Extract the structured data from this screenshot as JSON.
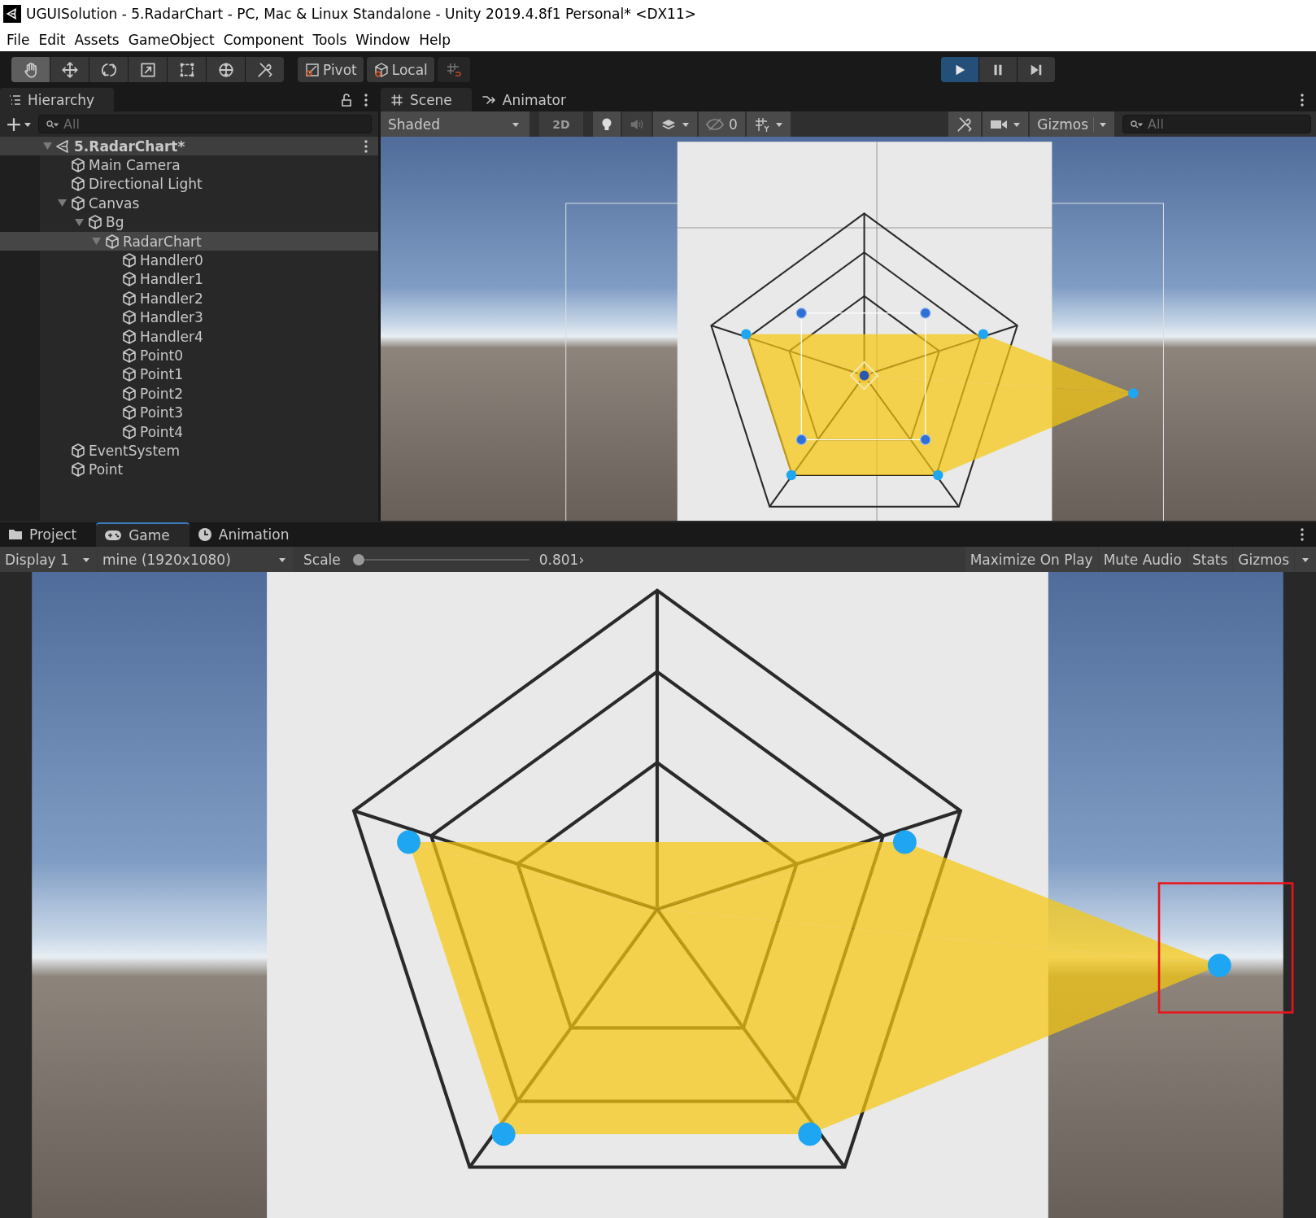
{
  "window": {
    "title": "UGUISolution - 5.RadarChart - PC, Mac & Linux Standalone - Unity 2019.4.8f1 Personal* <DX11>"
  },
  "menu_bar": [
    "File",
    "Edit",
    "Assets",
    "GameObject",
    "Component",
    "Tools",
    "Window",
    "Help"
  ],
  "toolbar": {
    "tools": [
      {
        "kind": "hand",
        "selected": true
      },
      {
        "kind": "move",
        "selected": false
      },
      {
        "kind": "rotate",
        "selected": false
      },
      {
        "kind": "scale",
        "selected": false
      },
      {
        "kind": "rect",
        "selected": false
      },
      {
        "kind": "transform",
        "selected": false
      },
      {
        "kind": "custom",
        "selected": false
      }
    ],
    "pivot": "Pivot",
    "space": "Local",
    "playback": [
      {
        "kind": "play",
        "selected": true
      },
      {
        "kind": "pause",
        "selected": false
      },
      {
        "kind": "step",
        "selected": false
      }
    ]
  },
  "hierarchy": {
    "tab": "Hierarchy",
    "search": {
      "placeholder": "All"
    },
    "tree": [
      {
        "label": "5.RadarChart*",
        "kind": "scene",
        "expanded": true,
        "children": [
          {
            "label": "Main Camera",
            "kind": "object",
            "selected": false
          },
          {
            "label": "Directional Light",
            "kind": "object",
            "selected": false
          },
          {
            "label": "Canvas",
            "kind": "object",
            "expanded": true,
            "selected": false,
            "children": [
              {
                "label": "Bg",
                "kind": "object",
                "expanded": true,
                "selected": false,
                "children": [
                  {
                    "label": "RadarChart",
                    "kind": "object",
                    "expanded": true,
                    "selected": true,
                    "children": [
                      {
                        "label": "Handler0",
                        "kind": "object",
                        "selected": false
                      },
                      {
                        "label": "Handler1",
                        "kind": "object",
                        "selected": false
                      },
                      {
                        "label": "Handler2",
                        "kind": "object",
                        "selected": false
                      },
                      {
                        "label": "Handler3",
                        "kind": "object",
                        "selected": false
                      },
                      {
                        "label": "Handler4",
                        "kind": "object",
                        "selected": false
                      },
                      {
                        "label": "Point0",
                        "kind": "object",
                        "selected": false
                      },
                      {
                        "label": "Point1",
                        "kind": "object",
                        "selected": false
                      },
                      {
                        "label": "Point2",
                        "kind": "object",
                        "selected": false
                      },
                      {
                        "label": "Point3",
                        "kind": "object",
                        "selected": false
                      },
                      {
                        "label": "Point4",
                        "kind": "object",
                        "selected": false
                      }
                    ]
                  }
                ]
              }
            ]
          },
          {
            "label": "EventSystem",
            "kind": "object",
            "selected": false
          },
          {
            "label": "Point",
            "kind": "object",
            "selected": false
          }
        ]
      }
    ]
  },
  "scene_view": {
    "tabs": [
      {
        "label": "Scene",
        "kind": "scene",
        "selected": true
      },
      {
        "label": "Animator",
        "kind": "animator",
        "selected": false
      }
    ],
    "shading": "Shaded",
    "toggles": [
      {
        "kind": "dimension",
        "label": "2D",
        "on": false
      },
      {
        "kind": "lighting",
        "on": true
      },
      {
        "kind": "audio",
        "on": false
      }
    ],
    "hidden_count": "0",
    "gizmos": "Gizmos",
    "search": {
      "placeholder": "All"
    }
  },
  "game_view": {
    "tabs": [
      {
        "label": "Project",
        "kind": "project",
        "selected": false
      },
      {
        "label": "Game",
        "kind": "game",
        "selected": true
      },
      {
        "label": "Animation",
        "kind": "animation",
        "selected": false
      }
    ],
    "display": "Display 1",
    "resolution": "mine (1920x1080)",
    "scale": {
      "label": "Scale",
      "level": 0,
      "reading": "0.801›"
    },
    "buttons": [
      "Maximize On Play",
      "Mute Audio",
      "Stats",
      "Gizmos"
    ]
  }
}
